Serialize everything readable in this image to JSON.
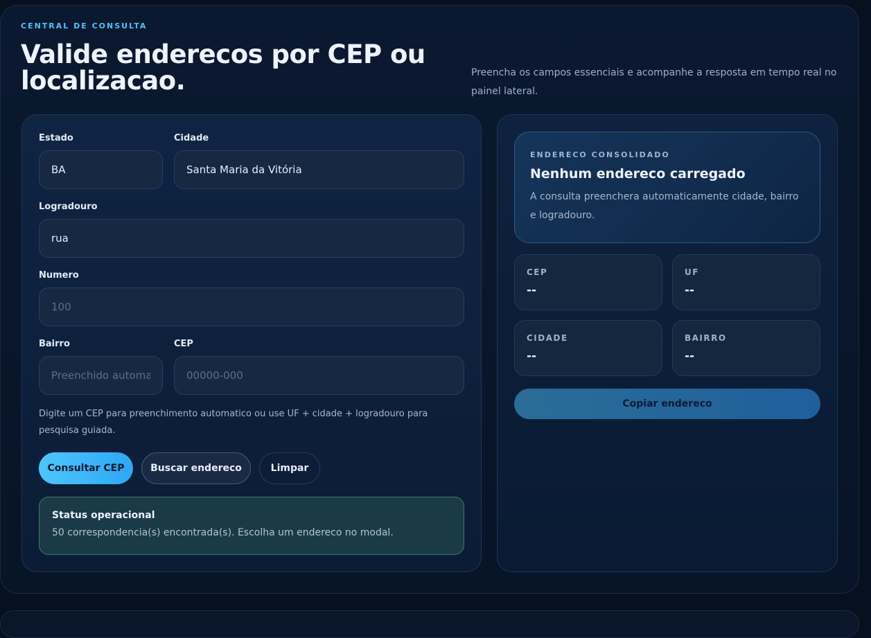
{
  "header": {
    "eyebrow": "CENTRAL DE CONSULTA",
    "title": "Valide enderecos por CEP ou localizacao.",
    "subtitle": "Preencha os campos essenciais e acompanhe a resposta em tempo real no painel lateral."
  },
  "form": {
    "estado": {
      "label": "Estado",
      "value": "BA"
    },
    "cidade": {
      "label": "Cidade",
      "value": "Santa Maria da Vitória"
    },
    "logradouro": {
      "label": "Logradouro",
      "value": "rua"
    },
    "numero": {
      "label": "Numero",
      "value": "",
      "placeholder": "100"
    },
    "bairro": {
      "label": "Bairro",
      "value": "",
      "placeholder": "Preenchido automaticamente"
    },
    "cep": {
      "label": "CEP",
      "value": "",
      "placeholder": "00000-000"
    },
    "hint": "Digite um CEP para preenchimento automatico ou use UF + cidade + logradouro para pesquisa guiada.",
    "buttons": {
      "consultar": "Consultar CEP",
      "buscar": "Buscar endereco",
      "limpar": "Limpar"
    },
    "status": {
      "title": "Status operacional",
      "text": "50 correspondencia(s) encontrada(s). Escolha um endereco no modal."
    }
  },
  "result": {
    "eyebrow": "ENDERECO CONSOLIDADO",
    "title": "Nenhum endereco carregado",
    "text": "A consulta preenchera automaticamente cidade, bairro e logradouro.",
    "tiles": {
      "cep": {
        "label": "CEP",
        "value": "--"
      },
      "uf": {
        "label": "UF",
        "value": "--"
      },
      "cidade": {
        "label": "CIDADE",
        "value": "--"
      },
      "bairro": {
        "label": "BAIRRO",
        "value": "--"
      }
    },
    "copy_label": "Copiar endereco"
  }
}
